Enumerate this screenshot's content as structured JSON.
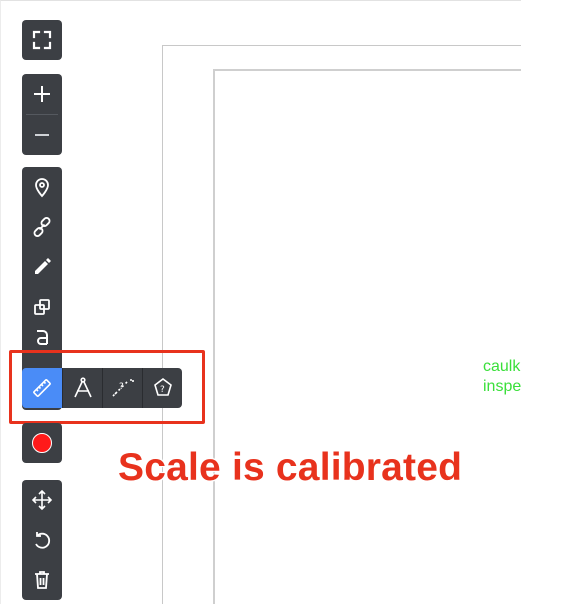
{
  "viewer": {
    "note_text": "caulk\ninspe",
    "note_color": "#3adf3a"
  },
  "toolbar": {
    "view": [
      {
        "icon": "fullscreen-icon"
      }
    ],
    "zoom": [
      {
        "icon": "zoom-in-icon"
      },
      {
        "icon": "zoom-out-icon"
      }
    ],
    "markup": [
      {
        "icon": "location-pin-icon"
      },
      {
        "icon": "link-icon"
      },
      {
        "icon": "pencil-icon"
      },
      {
        "icon": "shapes-icon"
      },
      {
        "icon": "text-icon"
      },
      {
        "icon": "ruler-icon",
        "active": true
      }
    ],
    "measure_flyout": [
      {
        "icon": "ruler-icon",
        "active": true
      },
      {
        "icon": "compass-angle-icon"
      },
      {
        "icon": "calibrate-scale-icon"
      },
      {
        "icon": "area-polygon-icon"
      }
    ],
    "record": [
      {
        "icon": "record-icon"
      }
    ],
    "edit": [
      {
        "icon": "move-icon"
      },
      {
        "icon": "rotate-icon"
      },
      {
        "icon": "trash-icon"
      }
    ]
  },
  "annotation": {
    "callout": "Scale is calibrated",
    "color": "#e8321d"
  },
  "colors": {
    "toolbar_bg": "#3c3f44",
    "active_tool": "#4a8cf7"
  }
}
